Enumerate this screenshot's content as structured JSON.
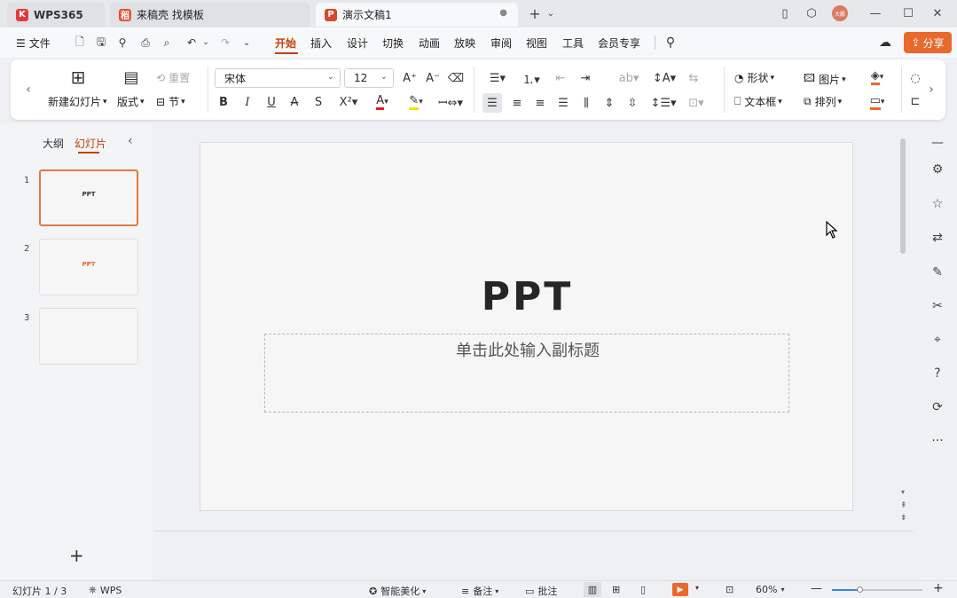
{
  "tabs": [
    {
      "label": "WPS365"
    },
    {
      "label": "来稿壳 找模板"
    },
    {
      "label": "演示文稿1"
    }
  ],
  "titlebar": {
    "avatar_text": "大鹏"
  },
  "menu": {
    "file_label": "文件",
    "tabs": [
      "开始",
      "插入",
      "设计",
      "切换",
      "动画",
      "放映",
      "审阅",
      "视图",
      "工具",
      "会员专享"
    ],
    "share_label": "分享"
  },
  "ribbon": {
    "new_slide": "新建幻灯片",
    "layout": "版式",
    "reset": "重置",
    "section": "节",
    "font_name": "宋体",
    "font_size": "12",
    "shape": "形状",
    "image": "图片",
    "textbox": "文本框",
    "arrange": "排列"
  },
  "leftpanel": {
    "outline_tab": "大纲",
    "slides_tab": "幻灯片",
    "slides": [
      {
        "num": "1",
        "text": "PPT"
      },
      {
        "num": "2",
        "text": "PPT"
      },
      {
        "num": "3",
        "text": ""
      }
    ],
    "add_label": "+"
  },
  "slide": {
    "title": "PPT",
    "subtitle_placeholder": "单击此处输入副标题"
  },
  "status": {
    "slide_counter": "幻灯片 1 / 3",
    "theme": "WPS",
    "beautify": "智能美化",
    "notes": "备注",
    "comments": "批注",
    "zoom": "60%",
    "zoom_fraction": 0.3
  },
  "colors": {
    "accent": "#c2410c",
    "share_button": "#e8692c",
    "wps_red": "#e03a3e",
    "ppt_tab_icon": "#d9472b"
  }
}
